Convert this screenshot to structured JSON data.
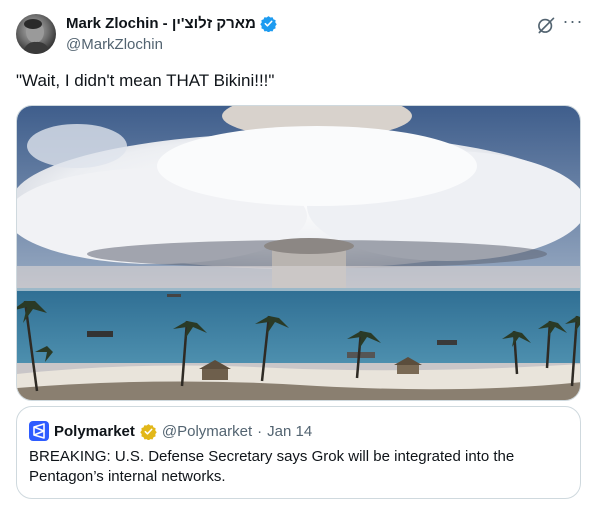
{
  "tweet": {
    "author_name": "Mark Zlochin - מארק זלוצ'ין",
    "author_handle": "@MarkZlochin",
    "text": "\"Wait, I didn't mean THAT Bikini!!!\"",
    "more_label": "···"
  },
  "quote": {
    "author_name": "Polymarket",
    "author_handle": "@Polymarket",
    "separator": "·",
    "date": "Jan 14",
    "text": "BREAKING: U.S. Defense Secretary says Grok will be integrated into the Pentagon’s internal networks."
  },
  "colors": {
    "verified_blue": "#1d9bf0",
    "verified_gold": "#e2b719",
    "polymarket_blue": "#2e5cff",
    "secondary_text": "#536471"
  },
  "icons": {
    "verified": "verified-badge-icon",
    "grok": "grok-icon",
    "more": "more-icon",
    "polymarket": "polymarket-logo-icon"
  }
}
